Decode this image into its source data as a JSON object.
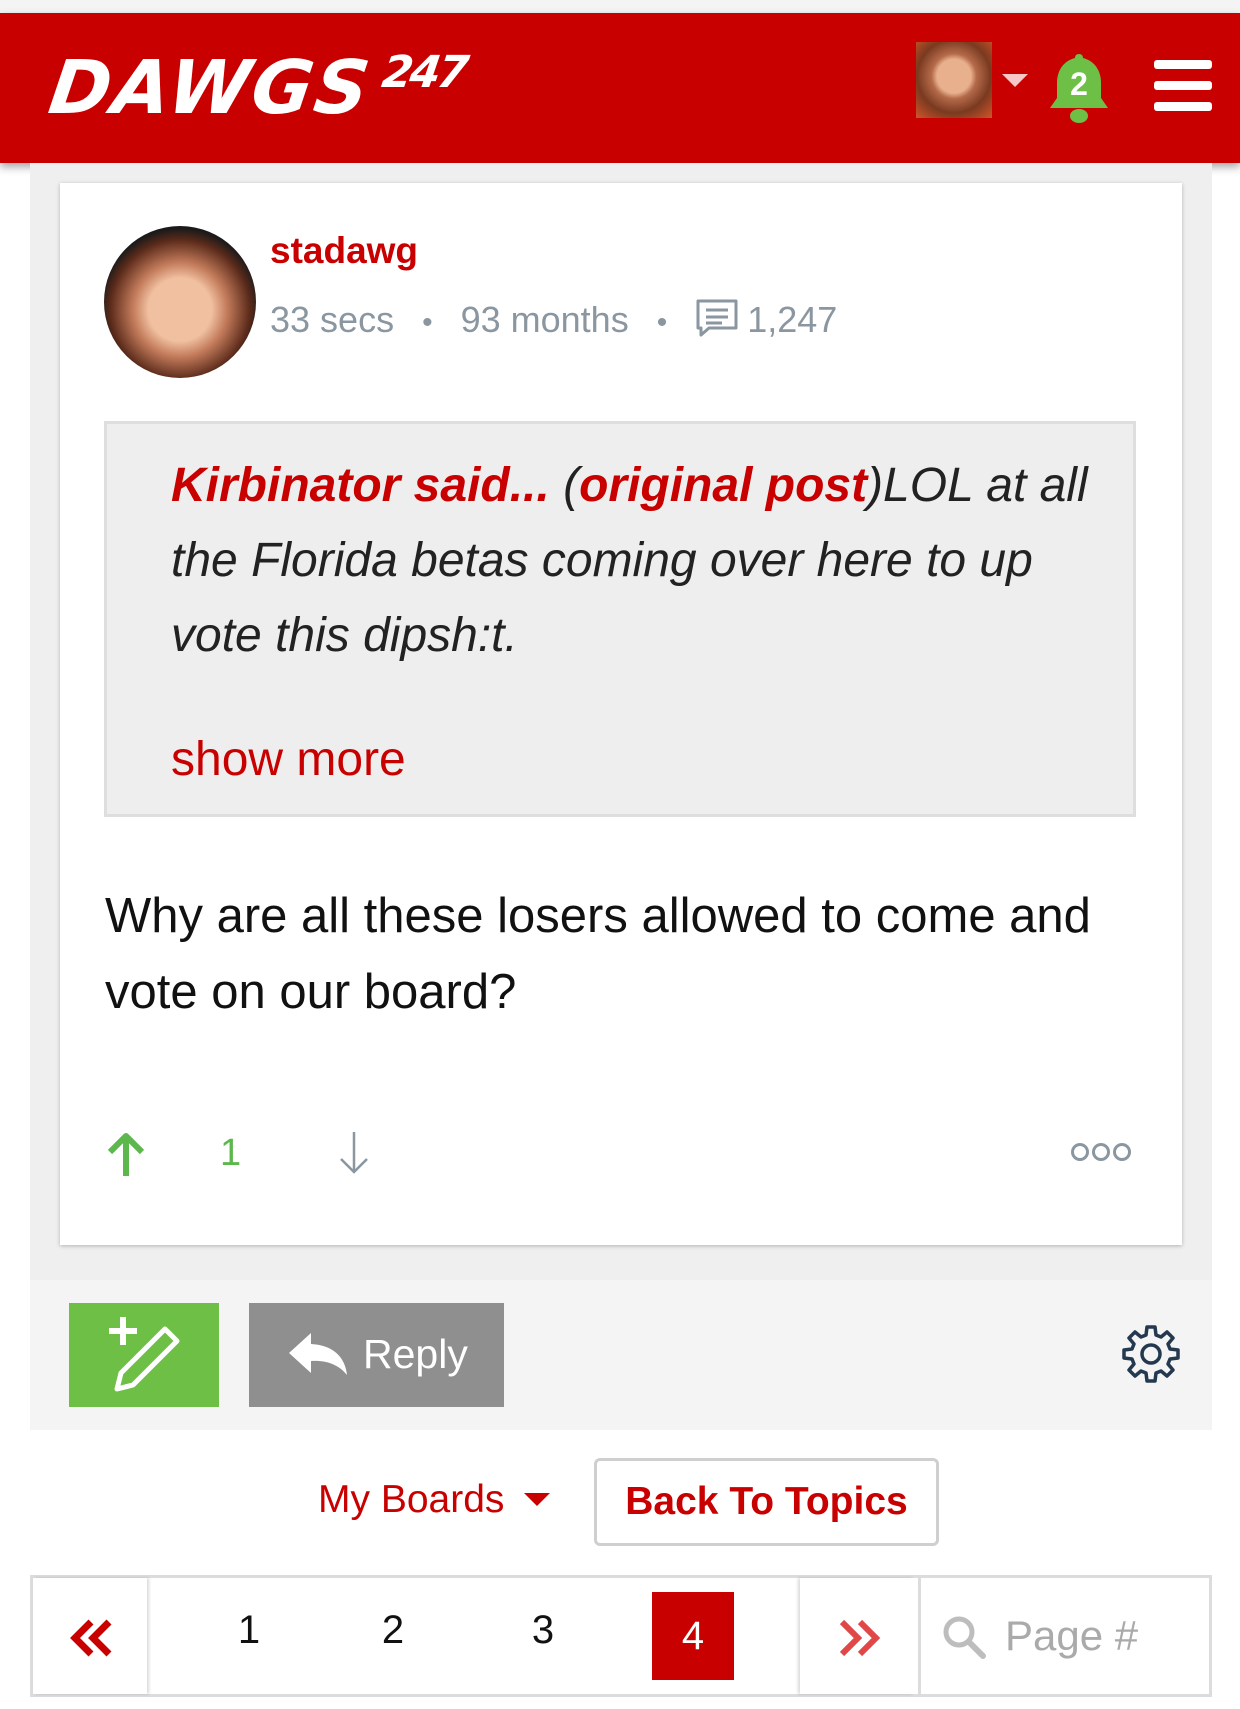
{
  "header": {
    "logo_main": "DAWGS",
    "logo_num": "247",
    "notification_count": "2",
    "brand_color": "#c90000"
  },
  "post": {
    "username": "stadawg",
    "time_ago": "33 secs",
    "member_for": "93 months",
    "post_count": "1,247",
    "quote": {
      "author": "Kirbinator said...",
      "open_paren": " (",
      "link_label": "original post",
      "close_paren": ")",
      "text": "LOL at all the Florida betas coming over here to up vote this dipsh:t.",
      "show_more": "show more"
    },
    "body": "Why are all these losers allowed to come and vote on our board?",
    "votes": "1",
    "icons": {
      "upvote": "arrow-up-icon",
      "downvote": "arrow-down-icon",
      "more": "more-dots-icon"
    }
  },
  "toolbar": {
    "reply_label": "Reply",
    "new_post_color": "#6dbf45"
  },
  "nav": {
    "my_boards_label": "My Boards",
    "back_to_topics_label": "Back To Topics"
  },
  "pagination": {
    "pages": [
      "1",
      "2",
      "3"
    ],
    "current": "4",
    "search_placeholder": "Page #"
  }
}
